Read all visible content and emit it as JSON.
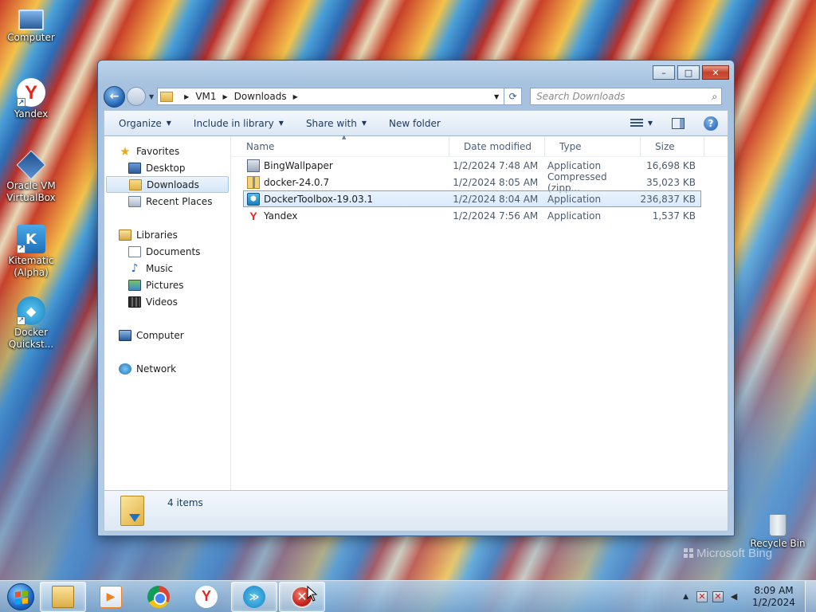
{
  "desktop": {
    "icons": [
      {
        "label": "Computer",
        "icon": "computer-icon"
      },
      {
        "label": "Yandex",
        "icon": "yandex-icon"
      },
      {
        "label": "Oracle VM VirtualBox",
        "icon": "virtualbox-icon"
      },
      {
        "label": "Kitematic (Alpha)",
        "icon": "kitematic-icon"
      },
      {
        "label": "Docker Quickst...",
        "icon": "docker-icon"
      },
      {
        "label": "Recycle Bin",
        "icon": "recycle-bin-icon"
      }
    ],
    "watermark": "Microsoft Bing"
  },
  "window": {
    "title_buttons": {
      "minimize": "–",
      "maximize": "□",
      "close": "✕"
    },
    "address": {
      "segments": [
        "VM1",
        "Downloads"
      ],
      "search_placeholder": "Search Downloads"
    },
    "toolbar": {
      "organize": "Organize",
      "include_in_library": "Include in library",
      "share_with": "Share with",
      "new_folder": "New folder",
      "help": "?"
    },
    "nav": {
      "favorites": "Favorites",
      "desktop": "Desktop",
      "downloads": "Downloads",
      "recent_places": "Recent Places",
      "libraries": "Libraries",
      "documents": "Documents",
      "music": "Music",
      "pictures": "Pictures",
      "videos": "Videos",
      "computer": "Computer",
      "network": "Network"
    },
    "columns": {
      "name": "Name",
      "date": "Date modified",
      "type": "Type",
      "size": "Size"
    },
    "files": [
      {
        "name": "BingWallpaper",
        "date": "1/2/2024 7:48 AM",
        "type": "Application",
        "size": "16,698 KB",
        "icon": "application-icon"
      },
      {
        "name": "docker-24.0.7",
        "date": "1/2/2024 8:05 AM",
        "type": "Compressed (zipp...",
        "size": "35,023 KB",
        "icon": "zip-folder-icon"
      },
      {
        "name": "DockerToolbox-19.03.1",
        "date": "1/2/2024 8:04 AM",
        "type": "Application",
        "size": "236,837 KB",
        "icon": "docker-installer-icon",
        "selected": true
      },
      {
        "name": "Yandex",
        "date": "1/2/2024 7:56 AM",
        "type": "Application",
        "size": "1,537 KB",
        "icon": "yandex-icon"
      }
    ],
    "status": {
      "item_count": "4 items"
    }
  },
  "taskbar": {
    "clock_time": "8:09 AM",
    "clock_date": "1/2/2024",
    "apps": [
      "explorer",
      "media-player",
      "chrome",
      "yandex",
      "docker",
      "error-app"
    ]
  }
}
